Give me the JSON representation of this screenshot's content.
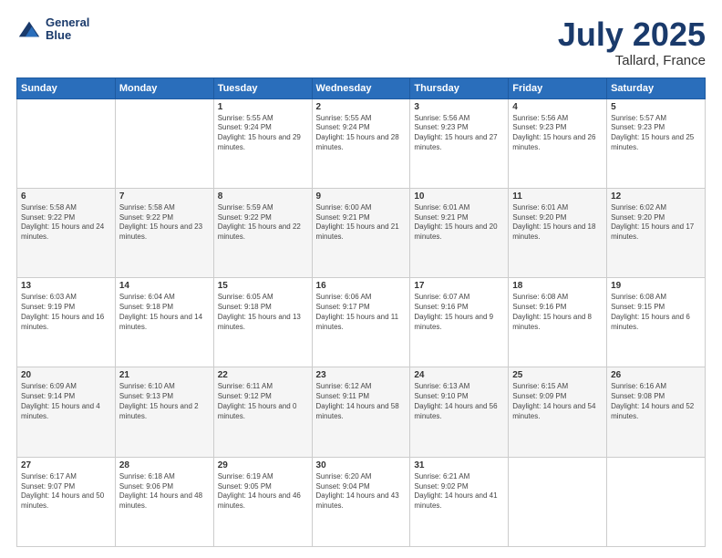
{
  "header": {
    "logo_line1": "General",
    "logo_line2": "Blue",
    "title": "July 2025",
    "subtitle": "Tallard, France"
  },
  "weekdays": [
    "Sunday",
    "Monday",
    "Tuesday",
    "Wednesday",
    "Thursday",
    "Friday",
    "Saturday"
  ],
  "weeks": [
    [
      {
        "day": "",
        "sunrise": "",
        "sunset": "",
        "daylight": ""
      },
      {
        "day": "",
        "sunrise": "",
        "sunset": "",
        "daylight": ""
      },
      {
        "day": "1",
        "sunrise": "Sunrise: 5:55 AM",
        "sunset": "Sunset: 9:24 PM",
        "daylight": "Daylight: 15 hours and 29 minutes."
      },
      {
        "day": "2",
        "sunrise": "Sunrise: 5:55 AM",
        "sunset": "Sunset: 9:24 PM",
        "daylight": "Daylight: 15 hours and 28 minutes."
      },
      {
        "day": "3",
        "sunrise": "Sunrise: 5:56 AM",
        "sunset": "Sunset: 9:23 PM",
        "daylight": "Daylight: 15 hours and 27 minutes."
      },
      {
        "day": "4",
        "sunrise": "Sunrise: 5:56 AM",
        "sunset": "Sunset: 9:23 PM",
        "daylight": "Daylight: 15 hours and 26 minutes."
      },
      {
        "day": "5",
        "sunrise": "Sunrise: 5:57 AM",
        "sunset": "Sunset: 9:23 PM",
        "daylight": "Daylight: 15 hours and 25 minutes."
      }
    ],
    [
      {
        "day": "6",
        "sunrise": "Sunrise: 5:58 AM",
        "sunset": "Sunset: 9:22 PM",
        "daylight": "Daylight: 15 hours and 24 minutes."
      },
      {
        "day": "7",
        "sunrise": "Sunrise: 5:58 AM",
        "sunset": "Sunset: 9:22 PM",
        "daylight": "Daylight: 15 hours and 23 minutes."
      },
      {
        "day": "8",
        "sunrise": "Sunrise: 5:59 AM",
        "sunset": "Sunset: 9:22 PM",
        "daylight": "Daylight: 15 hours and 22 minutes."
      },
      {
        "day": "9",
        "sunrise": "Sunrise: 6:00 AM",
        "sunset": "Sunset: 9:21 PM",
        "daylight": "Daylight: 15 hours and 21 minutes."
      },
      {
        "day": "10",
        "sunrise": "Sunrise: 6:01 AM",
        "sunset": "Sunset: 9:21 PM",
        "daylight": "Daylight: 15 hours and 20 minutes."
      },
      {
        "day": "11",
        "sunrise": "Sunrise: 6:01 AM",
        "sunset": "Sunset: 9:20 PM",
        "daylight": "Daylight: 15 hours and 18 minutes."
      },
      {
        "day": "12",
        "sunrise": "Sunrise: 6:02 AM",
        "sunset": "Sunset: 9:20 PM",
        "daylight": "Daylight: 15 hours and 17 minutes."
      }
    ],
    [
      {
        "day": "13",
        "sunrise": "Sunrise: 6:03 AM",
        "sunset": "Sunset: 9:19 PM",
        "daylight": "Daylight: 15 hours and 16 minutes."
      },
      {
        "day": "14",
        "sunrise": "Sunrise: 6:04 AM",
        "sunset": "Sunset: 9:18 PM",
        "daylight": "Daylight: 15 hours and 14 minutes."
      },
      {
        "day": "15",
        "sunrise": "Sunrise: 6:05 AM",
        "sunset": "Sunset: 9:18 PM",
        "daylight": "Daylight: 15 hours and 13 minutes."
      },
      {
        "day": "16",
        "sunrise": "Sunrise: 6:06 AM",
        "sunset": "Sunset: 9:17 PM",
        "daylight": "Daylight: 15 hours and 11 minutes."
      },
      {
        "day": "17",
        "sunrise": "Sunrise: 6:07 AM",
        "sunset": "Sunset: 9:16 PM",
        "daylight": "Daylight: 15 hours and 9 minutes."
      },
      {
        "day": "18",
        "sunrise": "Sunrise: 6:08 AM",
        "sunset": "Sunset: 9:16 PM",
        "daylight": "Daylight: 15 hours and 8 minutes."
      },
      {
        "day": "19",
        "sunrise": "Sunrise: 6:08 AM",
        "sunset": "Sunset: 9:15 PM",
        "daylight": "Daylight: 15 hours and 6 minutes."
      }
    ],
    [
      {
        "day": "20",
        "sunrise": "Sunrise: 6:09 AM",
        "sunset": "Sunset: 9:14 PM",
        "daylight": "Daylight: 15 hours and 4 minutes."
      },
      {
        "day": "21",
        "sunrise": "Sunrise: 6:10 AM",
        "sunset": "Sunset: 9:13 PM",
        "daylight": "Daylight: 15 hours and 2 minutes."
      },
      {
        "day": "22",
        "sunrise": "Sunrise: 6:11 AM",
        "sunset": "Sunset: 9:12 PM",
        "daylight": "Daylight: 15 hours and 0 minutes."
      },
      {
        "day": "23",
        "sunrise": "Sunrise: 6:12 AM",
        "sunset": "Sunset: 9:11 PM",
        "daylight": "Daylight: 14 hours and 58 minutes."
      },
      {
        "day": "24",
        "sunrise": "Sunrise: 6:13 AM",
        "sunset": "Sunset: 9:10 PM",
        "daylight": "Daylight: 14 hours and 56 minutes."
      },
      {
        "day": "25",
        "sunrise": "Sunrise: 6:15 AM",
        "sunset": "Sunset: 9:09 PM",
        "daylight": "Daylight: 14 hours and 54 minutes."
      },
      {
        "day": "26",
        "sunrise": "Sunrise: 6:16 AM",
        "sunset": "Sunset: 9:08 PM",
        "daylight": "Daylight: 14 hours and 52 minutes."
      }
    ],
    [
      {
        "day": "27",
        "sunrise": "Sunrise: 6:17 AM",
        "sunset": "Sunset: 9:07 PM",
        "daylight": "Daylight: 14 hours and 50 minutes."
      },
      {
        "day": "28",
        "sunrise": "Sunrise: 6:18 AM",
        "sunset": "Sunset: 9:06 PM",
        "daylight": "Daylight: 14 hours and 48 minutes."
      },
      {
        "day": "29",
        "sunrise": "Sunrise: 6:19 AM",
        "sunset": "Sunset: 9:05 PM",
        "daylight": "Daylight: 14 hours and 46 minutes."
      },
      {
        "day": "30",
        "sunrise": "Sunrise: 6:20 AM",
        "sunset": "Sunset: 9:04 PM",
        "daylight": "Daylight: 14 hours and 43 minutes."
      },
      {
        "day": "31",
        "sunrise": "Sunrise: 6:21 AM",
        "sunset": "Sunset: 9:02 PM",
        "daylight": "Daylight: 14 hours and 41 minutes."
      },
      {
        "day": "",
        "sunrise": "",
        "sunset": "",
        "daylight": ""
      },
      {
        "day": "",
        "sunrise": "",
        "sunset": "",
        "daylight": ""
      }
    ]
  ]
}
